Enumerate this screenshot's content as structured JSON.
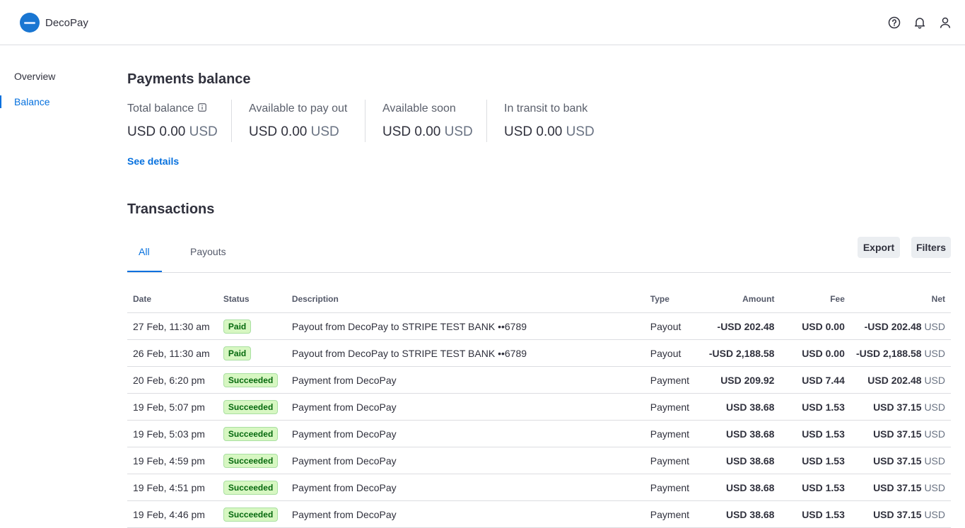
{
  "header": {
    "brand": "DecoPay",
    "icons": [
      "help-icon",
      "bell-icon",
      "user-icon"
    ]
  },
  "sidebar": {
    "items": [
      {
        "label": "Overview",
        "active": false
      },
      {
        "label": "Balance",
        "active": true
      }
    ]
  },
  "balance": {
    "title": "Payments balance",
    "columns": [
      {
        "label": "Total balance",
        "value": "USD 0.00",
        "currency": "USD",
        "info_icon": "info-icon"
      },
      {
        "label": "Available to pay out",
        "value": "USD 0.00",
        "currency": "USD"
      },
      {
        "label": "Available soon",
        "value": "USD 0.00",
        "currency": "USD"
      },
      {
        "label": "In transit to bank",
        "value": "USD 0.00",
        "currency": "USD"
      }
    ],
    "see_details": "See details"
  },
  "transactions": {
    "title": "Transactions",
    "tabs": [
      {
        "label": "All",
        "active": true
      },
      {
        "label": "Payouts",
        "active": false
      }
    ],
    "export_label": "Export",
    "filters_label": "Filters",
    "columns": [
      "Date",
      "Status",
      "Description",
      "Type",
      "Amount",
      "Fee",
      "Net"
    ],
    "rows": [
      {
        "date": "27 Feb, 11:30 am",
        "status": "Paid",
        "description": "Payout from DecoPay to STRIPE TEST BANK ••6789",
        "type": "Payout",
        "amount": "-USD 202.48",
        "fee": "USD 0.00",
        "net": "-USD 202.48",
        "net_currency": "USD"
      },
      {
        "date": "26 Feb, 11:30 am",
        "status": "Paid",
        "description": "Payout from DecoPay to STRIPE TEST BANK ••6789",
        "type": "Payout",
        "amount": "-USD 2,188.58",
        "fee": "USD 0.00",
        "net": "-USD 2,188.58",
        "net_currency": "USD"
      },
      {
        "date": "20 Feb, 6:20 pm",
        "status": "Succeeded",
        "description": "Payment from DecoPay",
        "type": "Payment",
        "amount": "USD 209.92",
        "fee": "USD 7.44",
        "net": "USD 202.48",
        "net_currency": "USD"
      },
      {
        "date": "19 Feb, 5:07 pm",
        "status": "Succeeded",
        "description": "Payment from DecoPay",
        "type": "Payment",
        "amount": "USD 38.68",
        "fee": "USD 1.53",
        "net": "USD 37.15",
        "net_currency": "USD"
      },
      {
        "date": "19 Feb, 5:03 pm",
        "status": "Succeeded",
        "description": "Payment from DecoPay",
        "type": "Payment",
        "amount": "USD 38.68",
        "fee": "USD 1.53",
        "net": "USD 37.15",
        "net_currency": "USD"
      },
      {
        "date": "19 Feb, 4:59 pm",
        "status": "Succeeded",
        "description": "Payment from DecoPay",
        "type": "Payment",
        "amount": "USD 38.68",
        "fee": "USD 1.53",
        "net": "USD 37.15",
        "net_currency": "USD"
      },
      {
        "date": "19 Feb, 4:51 pm",
        "status": "Succeeded",
        "description": "Payment from DecoPay",
        "type": "Payment",
        "amount": "USD 38.68",
        "fee": "USD 1.53",
        "net": "USD 37.15",
        "net_currency": "USD"
      },
      {
        "date": "19 Feb, 4:46 pm",
        "status": "Succeeded",
        "description": "Payment from DecoPay",
        "type": "Payment",
        "amount": "USD 38.68",
        "fee": "USD 1.53",
        "net": "USD 37.15",
        "net_currency": "USD"
      }
    ]
  },
  "colors": {
    "accent": "#0570de",
    "logo": "#1976d2",
    "badge_bg": "#d7f7c2",
    "badge_text": "#05690d"
  }
}
